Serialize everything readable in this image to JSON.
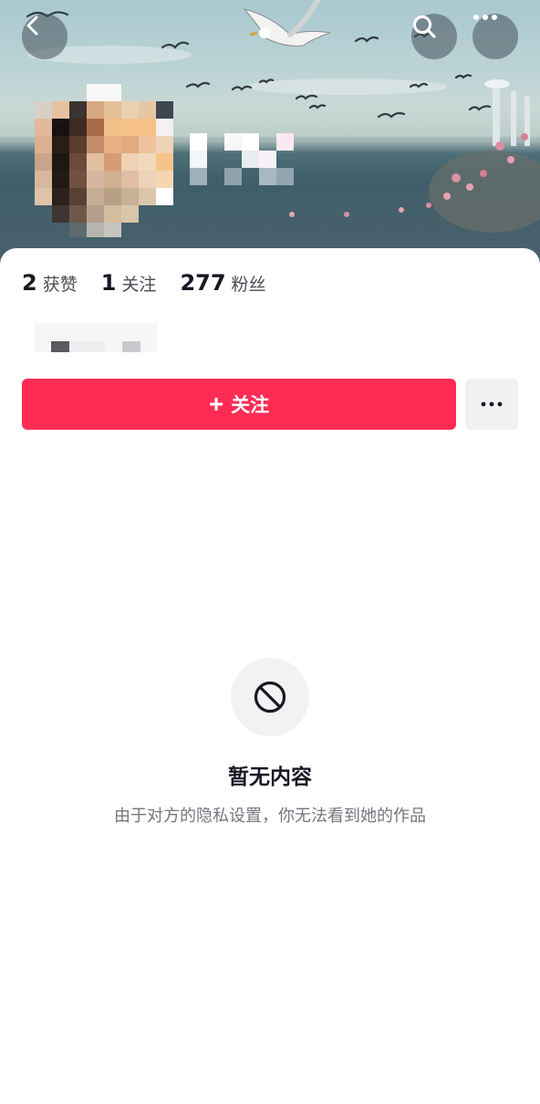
{
  "header": {
    "icons": {
      "back": "chevron-left-icon",
      "search": "search-icon",
      "more": "more-horizontal-icon"
    }
  },
  "stats": [
    {
      "value": "2",
      "label": "获赞"
    },
    {
      "value": "1",
      "label": "关注"
    },
    {
      "value": "277",
      "label": "粉丝"
    }
  ],
  "actions": {
    "follow_plus": "+",
    "follow_label": "关注",
    "more_icon": "more-horizontal-icon"
  },
  "empty_state": {
    "icon": "block-icon",
    "title": "暂无内容",
    "description": "由于对方的隐私设置，你无法看到她的作品"
  },
  "colors": {
    "accent": "#fe2c55",
    "text_primary": "#161823",
    "text_secondary": "#75777f"
  }
}
